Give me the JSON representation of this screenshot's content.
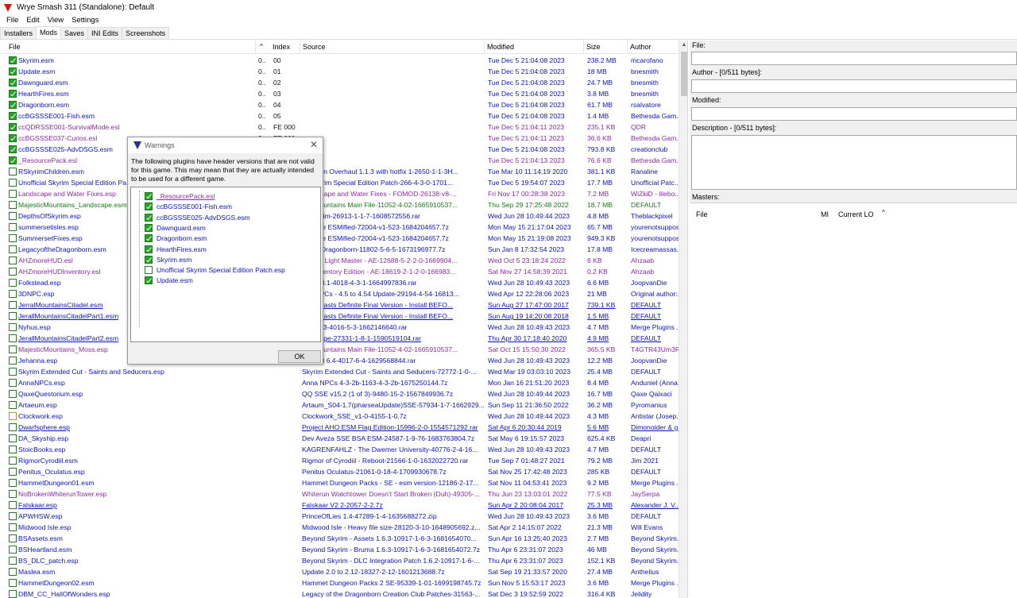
{
  "window": {
    "title": "Wrye Smash 311 (Standalone): Default"
  },
  "menu": [
    "File",
    "Edit",
    "View",
    "Settings"
  ],
  "tabs": [
    "Installers",
    "Mods",
    "Saves",
    "INI Edits",
    "Screenshots"
  ],
  "list": {
    "columns": {
      "file": "File",
      "index": "Index",
      "source": "Source",
      "modified": "Modified",
      "size": "Size",
      "author": "Author"
    },
    "rows": [
      {
        "c": true,
        "file": "Skyrim.esm",
        "m": "0..",
        "idx": "00",
        "src": "",
        "mod": "Tue Dec  5 21:04:08 2023",
        "size": "238.2 MB",
        "author": "mcarofano",
        "col": "blue"
      },
      {
        "c": true,
        "file": "Update.esm",
        "m": "0..",
        "idx": "01",
        "src": "",
        "mod": "Tue Dec  5 21:04:08 2023",
        "size": "18 MB",
        "author": "bnesmith",
        "col": "blue"
      },
      {
        "c": true,
        "file": "Dawnguard.esm",
        "m": "0..",
        "idx": "02",
        "src": "",
        "mod": "Tue Dec  5 21:04:08 2023",
        "size": "24.7 MB",
        "author": "bnesmith",
        "col": "blue"
      },
      {
        "c": true,
        "file": "HearthFires.esm",
        "m": "0..",
        "idx": "03",
        "src": "",
        "mod": "Tue Dec  5 21:04:08 2023",
        "size": "3.8 MB",
        "author": "bnesmith",
        "col": "blue"
      },
      {
        "c": true,
        "file": "Dragonborn.esm",
        "m": "0..",
        "idx": "04",
        "src": "",
        "mod": "Tue Dec  5 21:04:08 2023",
        "size": "61.7 MB",
        "author": "rsalvatore",
        "col": "blue"
      },
      {
        "c": true,
        "file": "ccBGSSSE001-Fish.esm",
        "m": "0..",
        "idx": "05",
        "src": "",
        "mod": "Tue Dec  5 21:04:08 2023",
        "size": "1.4 MB",
        "author": "Bethesda Gam...",
        "col": "blue"
      },
      {
        "c": true,
        "file": "ccQDRSSE001-SurvivalMode.esl",
        "m": "0..",
        "idx": "FE 000",
        "src": "",
        "mod": "Tue Dec  5 21:04:11 2023",
        "size": "235.1 KB",
        "author": "QDR",
        "col": "purple"
      },
      {
        "c": true,
        "file": "ccBGSSSE037-Curios.esl",
        "m": "0..",
        "idx": "FE 001",
        "src": "",
        "mod": "Tue Dec  5 21:04:11 2023",
        "size": "36.6 KB",
        "author": "Bethesda Gam...",
        "col": "purple"
      },
      {
        "c": true,
        "file": "ccBGSSSE025-AdvDSGS.esm",
        "m": "0..",
        "idx": "",
        "src": "",
        "mod": "Tue Dec  5 21:04:08 2023",
        "size": "793.8 KB",
        "author": "creationclub",
        "col": "blue"
      },
      {
        "c": true,
        "file": "_ResourcePack.esl",
        "m": "",
        "idx": "",
        "src": "",
        "mod": "Tue Dec  5 21:04:13 2023",
        "size": "76.6 KB",
        "author": "Bethesda Gam...",
        "col": "purple"
      },
      {
        "c": false,
        "file": "RSkyrimChildren.esm",
        "m": "",
        "idx": "",
        "src": "Children Overhaul 1.1.3 with hotfix 1-2650-1-1-3H...",
        "mod": "Tue Mar 10 11:14:19 2020",
        "size": "381.1 KB",
        "author": "Ranaline",
        "col": "blue"
      },
      {
        "c": false,
        "file": "Unofficial Skyrim Special Edition Pa...",
        "m": "",
        "idx": "",
        "src": "ial Skyrim Special Edition Patch-266-4-3-0-1701...",
        "mod": "Tue Dec  5 19:54:07 2023",
        "size": "17.7 MB",
        "author": "Unofficial Patc...",
        "col": "blue"
      },
      {
        "c": false,
        "file": "Landscape and Water Fixes.esp",
        "m": "",
        "idx": "",
        "src": "Landscape and Water Fixes - FOMOD-26138-v8-...",
        "mod": "Fri Nov 17 00:28:38 2023",
        "size": "7.2 MB",
        "author": "WiZkiD - lilebo...",
        "col": "purple"
      },
      {
        "c": false,
        "file": "MajesticMountains_Landscape.esm",
        "m": "",
        "idx": "",
        "src": "stic Mountains Main File-11052-4-02-1665910537...",
        "mod": "Thu Sep 29 17:25:48 2022",
        "size": "18.7 MB",
        "author": "DEFAULT",
        "col": "green"
      },
      {
        "c": false,
        "file": "DepthsOfSkyrim.esp",
        "m": "",
        "idx": "",
        "src": "of Skyrim-26913-1-1-7-1608572556.rar",
        "mod": "Wed Jun 28 10:49:44 2023",
        "size": "4.8 MB",
        "author": "Theblackpixel",
        "col": "blue"
      },
      {
        "c": false,
        "file": "summersetisles.esp",
        "m": "",
        "idx": "",
        "src": "rset Isle ESMified-72004-v1-523-1684204657.7z",
        "mod": "Mon May 15 21:17:04 2023",
        "size": "65.7 MB",
        "author": "yourenotsuppos...",
        "col": "blue"
      },
      {
        "c": false,
        "file": "SummersetFixes.esp",
        "m": "",
        "idx": "",
        "src": "rset Isle ESMified-72004-v1-523-1684204657.7z",
        "mod": "Mon May 15 21:19:08 2023",
        "size": "949.3 KB",
        "author": "yourenotsuppos...",
        "col": "blue"
      },
      {
        "c": false,
        "file": "LegacyoftheDragonborn.esm",
        "m": "",
        "idx": "",
        "src": "of the Dragonborn-11802-5-6-5-1673196977.7z",
        "mod": "Sun Jan  8 17:32:54 2023",
        "size": "17.8 MB",
        "author": "Icecreamassas...",
        "col": "blue"
      },
      {
        "c": false,
        "file": "AHZmoreHUD.esl",
        "m": "",
        "idx": "",
        "src": "UD SE Light Master - AE-12688-5-2-2-0-1669904...",
        "mod": "Wed Oct  5 23:18:24 2022",
        "size": "6 KB",
        "author": "Ahzaab",
        "col": "purple"
      },
      {
        "c": false,
        "file": "AHZmoreHUDInventory.esl",
        "m": "",
        "idx": "",
        "src": "UD Inventory Edition - AE-18619-2-1-2-0-166983...",
        "mod": "Sat Nov 27 14:58:39 2021",
        "size": "0.2 KB",
        "author": "Ahzaab",
        "col": "purple"
      },
      {
        "c": false,
        "file": "Folkstead.esp",
        "m": "",
        "idx": "",
        "src": "ead 4.3.1-4018-4-3-1-1664997836.rar",
        "mod": "Wed Jun 28 10:49:43 2023",
        "size": "6.6 MB",
        "author": "JoopvanDie",
        "col": "blue"
      },
      {
        "c": false,
        "file": "3DNPC.esp",
        "m": "",
        "idx": "",
        "src": "ting NPCs - 4.5 to 4.54 Update-29194-4-54-16813...",
        "mod": "Wed Apr 12 22:28:06 2023",
        "size": "21 MB",
        "author": "Original author:...",
        "col": "blue"
      },
      {
        "c": false,
        "file": "JerralMountainsCitadel.esm",
        "m": "",
        "idx": "",
        "src": "of Outcasts Definite Final Version - Install BEFO...",
        "mod": "Sun Aug 27 17:47:00 2017",
        "size": "739.1 KB",
        "author": "DEFAULT",
        "col": "blue",
        "u": true
      },
      {
        "c": false,
        "file": "JerallMountainsCitadelPart1.esm",
        "m": "",
        "idx": "",
        "src": "of Outcasts Definite Final Version - Install BEFO...",
        "mod": "Sun Aug 19 14:20:08 2018",
        "size": "1.5 MB",
        "author": "DEFAULT",
        "col": "blue",
        "u": true
      },
      {
        "c": false,
        "file": "Nyhus.esp",
        "m": "",
        "idx": "",
        "src": "SSE 5.3-4016-5-3-1662146640.rar",
        "mod": "Wed Jun 28 10:49:43 2023",
        "size": "4.7 MB",
        "author": "Merge Plugins ...",
        "col": "blue"
      },
      {
        "c": false,
        "file": "JerallMountainsCitadelPart2.esm",
        "m": "",
        "idx": "",
        "src": "st Refuge-27331-1-8-1-1590519104.rar",
        "mod": "Thu Apr 30 17:18:40 2020",
        "size": "4.9 MB",
        "author": "DEFAULT",
        "col": "blue",
        "u": true
      },
      {
        "c": false,
        "file": "MajesticMountains_Moss.esp",
        "m": "",
        "idx": "",
        "src": "stic Mountains Main File-11052-4-02-1665910537...",
        "mod": "Sat Oct 15 15:50:30 2022",
        "size": "365.5 KB",
        "author": "T4GTR43Um3R",
        "col": "purple"
      },
      {
        "c": false,
        "file": "Jehanna.esp",
        "m": "",
        "idx": "",
        "src": "aafstad 6.4-4017-6-4-1629568844.rar",
        "mod": "Wed Jun 28 10:49:43 2023",
        "size": "12.2 MB",
        "author": "JoopvanDie",
        "col": "blue"
      },
      {
        "c": false,
        "file": "Skyrim Extended Cut - Saints and Seducers.esp",
        "m": "",
        "idx": "",
        "src": "Skyrim Extended Cut - Saints and Seducers-72772-1-0-...",
        "mod": "Wed Mar 19 03:03:10 2023",
        "size": "25.4 MB",
        "author": "DEFAULT",
        "col": "blue"
      },
      {
        "c": false,
        "file": "AnnaNPCs.esp",
        "m": "",
        "idx": "",
        "src": "Anna NPCs 4-3-2b-1163-4-3-2b-1675250144.7z",
        "mod": "Mon Jan 16 21:51:20 2023",
        "size": "8.4 MB",
        "author": "Anduniel (Anna...",
        "col": "blue"
      },
      {
        "c": false,
        "file": "QaxeQuestorium.esp",
        "m": "",
        "idx": "",
        "src": "QQ SSE v15.2 (1 of 3)-9480-15-2-1567849936.7z",
        "mod": "Wed Jun 28 10:49:44 2023",
        "size": "16.7 MB",
        "author": "Qaxe Qaixaci",
        "col": "blue"
      },
      {
        "c": false,
        "file": "Artaeum.esp",
        "m": "",
        "idx": "",
        "src": "Artaum_S04-1.7(pharseaUpdate)SSE-57934-1-7-1662929...",
        "mod": "Sun Sep 11 21:36:50 2022",
        "size": "36.2 MB",
        "author": "Pyromanius",
        "col": "blue"
      },
      {
        "c": false,
        "file": "Clockwork.esp",
        "m": "",
        "idx": "",
        "src": "Clockwork_SSE_v1-0-4155-1-0.7z",
        "mod": "Wed Jun 28 10:49:44 2023",
        "size": "4.3 MB",
        "author": "Antistar (Josep...",
        "col": "blue",
        "o": true
      },
      {
        "c": false,
        "file": "Dwarfsphere.esp",
        "m": "",
        "idx": "",
        "src": "Project AHO ESM Flag Edition-15996-2-0-1554571292.rar",
        "mod": "Sat Apr  6 20:30:44 2019",
        "size": "5.6 MB",
        "author": "Dimonoider & g...",
        "col": "blue",
        "u": true
      },
      {
        "c": false,
        "file": "DA_Skyship.esp",
        "m": "",
        "idx": "",
        "src": "Dev Aveza SSE BSA ESM-24587-1-9-76-1683763804.7z",
        "mod": "Sat May  6 19:15:57 2023",
        "size": "625.4 KB",
        "author": "Deapri",
        "col": "blue"
      },
      {
        "c": false,
        "file": "StoicBooks.esp",
        "m": "",
        "idx": "",
        "src": "KAGRENFAHLZ - The Dwemer University-40776-2-4-16...",
        "mod": "Wed Jun 28 10:49:43 2023",
        "size": "4.7 MB",
        "author": "DEFAULT",
        "col": "blue"
      },
      {
        "c": false,
        "file": "RigmorCyrodiil.esm",
        "m": "",
        "idx": "",
        "src": "Rigmor of Cyrodiil - Reboot-21566-1-0-1632022720.rar",
        "mod": "Tue Sep  7 01:48:27 2021",
        "size": "79.2 MB",
        "author": "Jim 2021",
        "col": "blue"
      },
      {
        "c": false,
        "file": "Penitus_Oculatus.esp",
        "m": "",
        "idx": "",
        "src": "Penitus Oculatus-21061-0-18-4-1709930678.7z",
        "mod": "Sat Nov 25 17:42:48 2023",
        "size": "285 KB",
        "author": "DEFAULT",
        "col": "blue"
      },
      {
        "c": false,
        "file": "HammetDungeon01.esm",
        "m": "",
        "idx": "",
        "src": "Hammet Dungeon Packs - SE - esm version-12186-2-17...",
        "mod": "Sat Nov 11 04:53:41 2023",
        "size": "9.2 MB",
        "author": "Merge Plugins ...",
        "col": "blue"
      },
      {
        "c": false,
        "file": "NoBrokenWhiterunTower.esp",
        "m": "",
        "idx": "",
        "src": "Whiterun Watchtower Doesn't Start Broken (Duh)-49305-...",
        "mod": "Thu Jun 23 13:03:01 2022",
        "size": "77.5 KB",
        "author": "JaySerpa",
        "col": "purple"
      },
      {
        "c": false,
        "file": "Falskaar.esp",
        "m": "",
        "idx": "",
        "src": "Falskaar V2 2-2057-2-2.7z",
        "mod": "Sun Apr  2 20:08:04 2017",
        "size": "25.3 MB",
        "author": "Alexander J. V...",
        "col": "blue",
        "u": true
      },
      {
        "c": false,
        "file": "APWHSW.esp",
        "m": "",
        "idx": "",
        "src": "PrinceOfLies 1.4-47289-1-4-1635688272.zip",
        "mod": "Wed Jun 28 10:49:43 2023",
        "size": "3.6 MB",
        "author": "DEFAULT",
        "col": "blue"
      },
      {
        "c": false,
        "file": "Midwood Isle.esp",
        "m": "",
        "idx": "",
        "src": "Midwood Isle - Heavy file size-28120-3-10-1648905692.z...",
        "mod": "Sat Apr  2 14:15:07 2022",
        "size": "21.3 MB",
        "author": "Will Evans",
        "col": "blue"
      },
      {
        "c": false,
        "file": "BSAssets.esm",
        "m": "",
        "idx": "",
        "src": "Beyond Skyrim - Assets 1.6.3-10917-1-6-3-1681654070...",
        "mod": "Sun Apr 16 13:25:40 2023",
        "size": "2.7 MB",
        "author": "Beyond Skyrim...",
        "col": "blue"
      },
      {
        "c": false,
        "file": "BSHeartland.esm",
        "m": "",
        "idx": "",
        "src": "Beyond Skyrim - Bruma 1.6.3-10917-1-6-3-1681654072.7z",
        "mod": "Thu Apr  6 23:31:07 2023",
        "size": "46 MB",
        "author": "Beyond Skyrim...",
        "col": "blue"
      },
      {
        "c": false,
        "file": "BS_DLC_patch.esp",
        "m": "",
        "idx": "",
        "src": "Beyond Skyrim - DLC Integration Patch 1.6.2-10917-1-6-...",
        "mod": "Thu Apr  6 23:31:07 2023",
        "size": "152.1 KB",
        "author": "Beyond Skyrim...",
        "col": "blue"
      },
      {
        "c": false,
        "file": "Maslea.esm",
        "m": "",
        "idx": "",
        "src": "Update 2.0 to 2.12-18327-2-12-1601213688.7z",
        "mod": "Sat Sep 19 21:33:57 2020",
        "size": "27.4 MB",
        "author": "Anthelius",
        "col": "blue"
      },
      {
        "c": false,
        "file": "HammetDungeon02.esm",
        "m": "",
        "idx": "",
        "src": "Hammet Dungeon Packs 2 SE-95339-1-01-1699198745.7z",
        "mod": "Sun Nov  5 15:53:17 2023",
        "size": "3.6 MB",
        "author": "Merge Plugins ...",
        "col": "blue"
      },
      {
        "c": false,
        "file": "DBM_CC_HallOfWonders.esp",
        "m": "",
        "idx": "",
        "src": "Legacy of the Dragonborn Creation Club Patches-31563-...",
        "mod": "Sat Dec  3 19:52:59 2022",
        "size": "316.4 KB",
        "author": "Jelidity",
        "col": "blue"
      }
    ]
  },
  "details": {
    "file_label": "File:",
    "author_label": "Author - [0/511 bytes]:",
    "modified_label": "Modified:",
    "description_label": "Description - [0/511 bytes]:",
    "masters_label": "Masters:",
    "masters_columns": {
      "file": "File",
      "mi": "MI",
      "current_lo": "Current LO"
    }
  },
  "dialog": {
    "title": "Warnings",
    "message": "The following plugins have header versions that are not valid for this game. This may mean that they are actually intended to be used for a different game.",
    "items": [
      {
        "c": true,
        "t": "_ResourcePack.esl",
        "col": "purple",
        "u": true
      },
      {
        "c": true,
        "t": "ccBGSSSE001-Fish.esm",
        "col": "blue"
      },
      {
        "c": true,
        "t": "ccBGSSSE025-AdvDSGS.esm",
        "col": "blue"
      },
      {
        "c": true,
        "t": "Dawnguard.esm",
        "col": "blue"
      },
      {
        "c": true,
        "t": "Dragonborn.esm",
        "col": "blue"
      },
      {
        "c": true,
        "t": "HearthFires.esm",
        "col": "blue"
      },
      {
        "c": true,
        "t": "Skyrim.esm",
        "col": "blue"
      },
      {
        "c": false,
        "t": "Unofficial Skyrim Special Edition Patch.esp",
        "col": "blue"
      },
      {
        "c": true,
        "t": "Update.esm",
        "col": "blue"
      }
    ],
    "ok_label": "OK"
  }
}
